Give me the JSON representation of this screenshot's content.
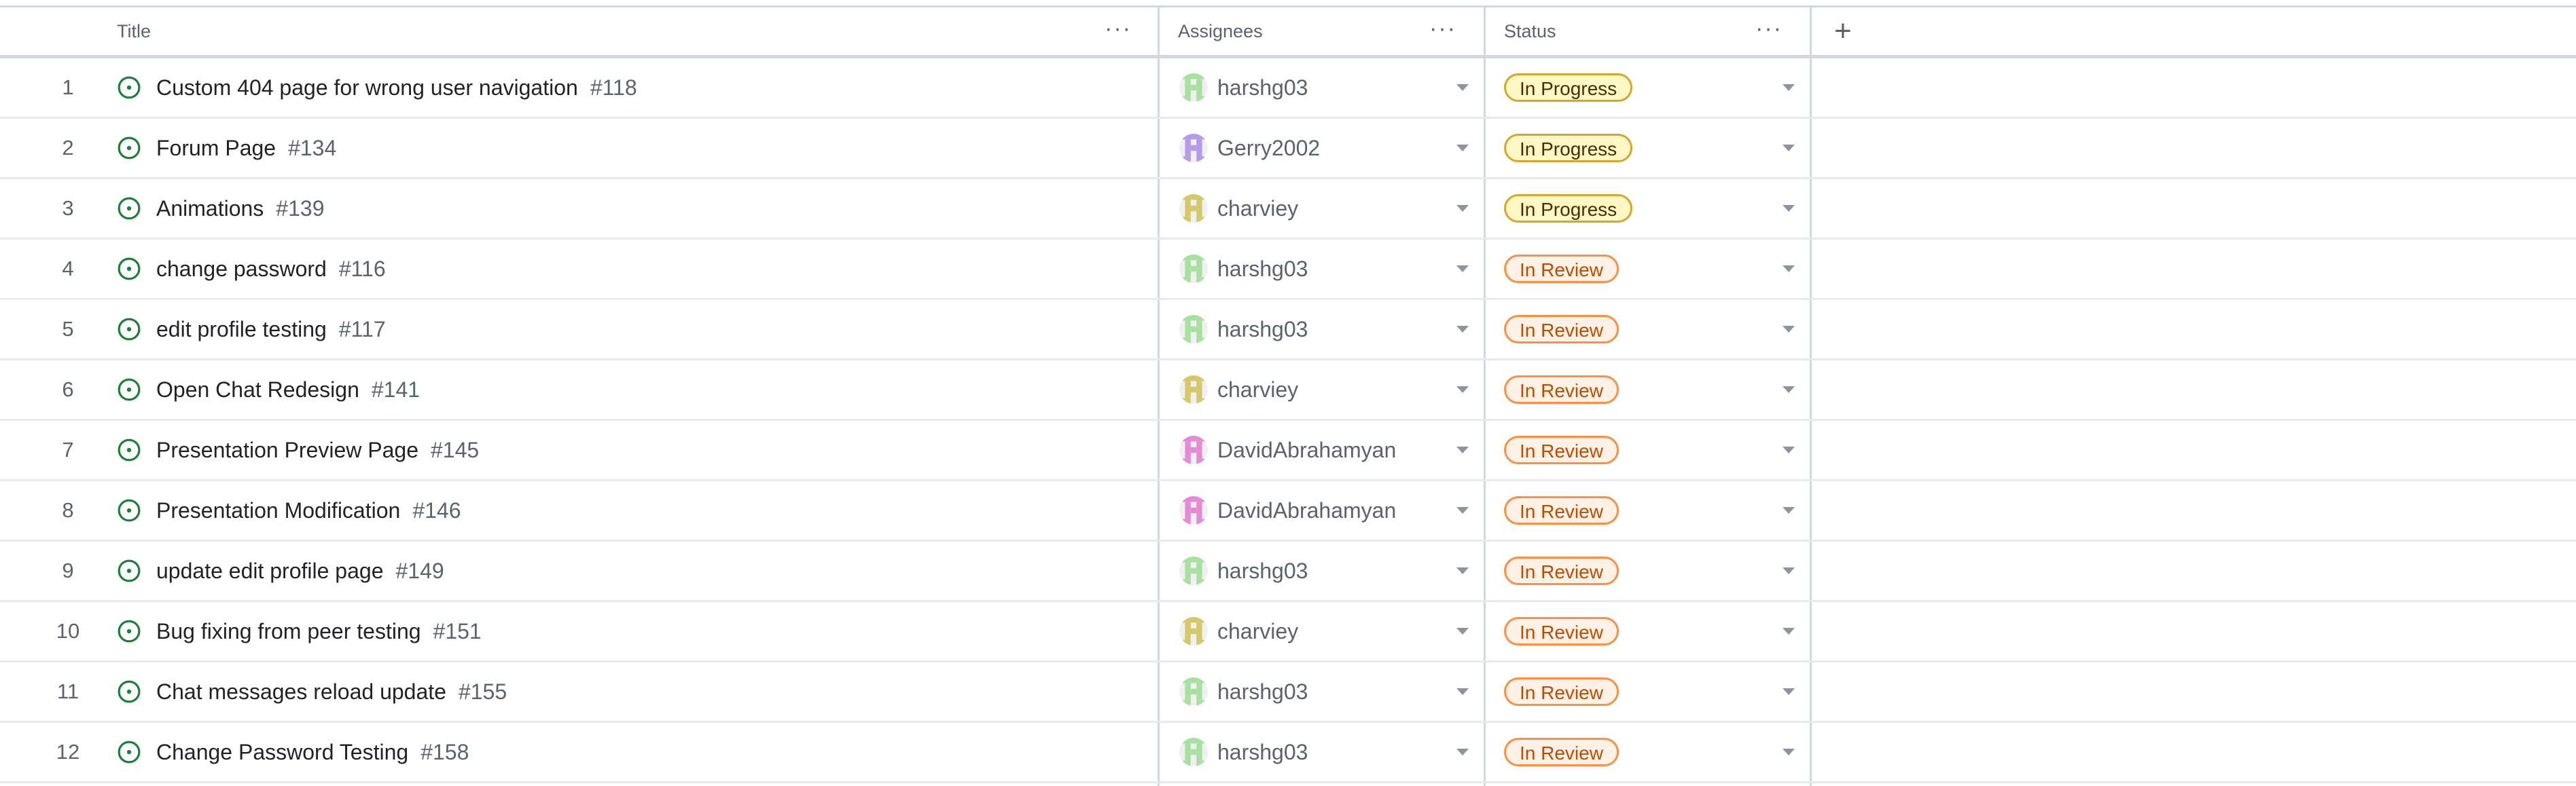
{
  "columns": {
    "title": "Title",
    "assignees": "Assignees",
    "status": "Status",
    "menu_glyph": "···",
    "add_glyph": "+"
  },
  "status_styles": {
    "In Progress": {
      "bg": "#fff8c5",
      "border": "#d4a72c",
      "color": "#4d2d00"
    },
    "In Review": {
      "bg": "#fff1e5",
      "border": "#fb8f44",
      "color": "#bc4c00"
    }
  },
  "avatar_colors": {
    "harshg03": "#a8e0a0",
    "Gerry2002": "#b49ae8",
    "charviey": "#d4c86a",
    "DavidAbrahamyan": "#e58ad4"
  },
  "rows": [
    {
      "num": "1",
      "title": "Custom 404 page for wrong user navigation",
      "issue": "#118",
      "assignee": "harshg03",
      "status": "In Progress"
    },
    {
      "num": "2",
      "title": "Forum Page",
      "issue": "#134",
      "assignee": "Gerry2002",
      "status": "In Progress"
    },
    {
      "num": "3",
      "title": "Animations",
      "issue": "#139",
      "assignee": "charviey",
      "status": "In Progress"
    },
    {
      "num": "4",
      "title": "change password",
      "issue": "#116",
      "assignee": "harshg03",
      "status": "In Review"
    },
    {
      "num": "5",
      "title": "edit profile testing",
      "issue": "#117",
      "assignee": "harshg03",
      "status": "In Review"
    },
    {
      "num": "6",
      "title": "Open Chat Redesign",
      "issue": "#141",
      "assignee": "charviey",
      "status": "In Review"
    },
    {
      "num": "7",
      "title": "Presentation Preview Page",
      "issue": "#145",
      "assignee": "DavidAbrahamyan",
      "status": "In Review"
    },
    {
      "num": "8",
      "title": "Presentation Modification",
      "issue": "#146",
      "assignee": "DavidAbrahamyan",
      "status": "In Review"
    },
    {
      "num": "9",
      "title": "update edit profile page",
      "issue": "#149",
      "assignee": "harshg03",
      "status": "In Review"
    },
    {
      "num": "10",
      "title": "Bug fixing from peer testing",
      "issue": "#151",
      "assignee": "charviey",
      "status": "In Review"
    },
    {
      "num": "11",
      "title": "Chat messages reload update",
      "issue": "#155",
      "assignee": "harshg03",
      "status": "In Review"
    },
    {
      "num": "12",
      "title": "Change Password Testing",
      "issue": "#158",
      "assignee": "harshg03",
      "status": "In Review"
    }
  ]
}
